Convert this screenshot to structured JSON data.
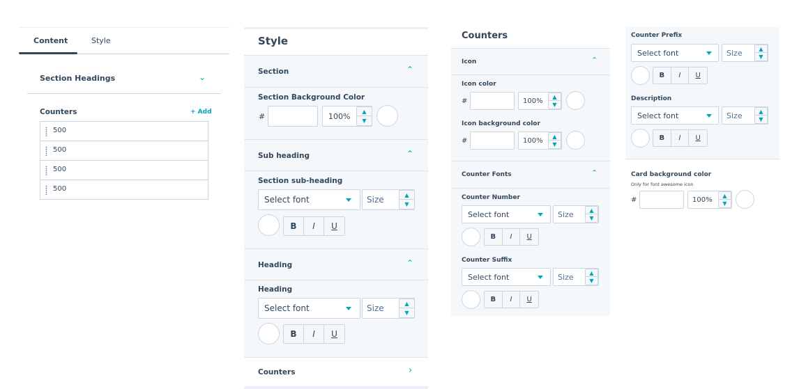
{
  "content_panel": {
    "tabs": [
      {
        "label": "Content"
      },
      {
        "label": "Style"
      }
    ],
    "section_headings_label": "Section Headings",
    "counters_label": "Counters",
    "add_label": "+ Add",
    "counter_items": [
      "500",
      "500",
      "500",
      "500"
    ]
  },
  "style_panel": {
    "title": "Style",
    "section": {
      "label": "Section",
      "bg_color_label": "Section Background Color",
      "hash": "#",
      "hex_value": "",
      "opacity": "100%"
    },
    "sub_heading": {
      "label": "Sub heading",
      "field_label": "Section sub-heading",
      "font_placeholder": "Select font",
      "size_placeholder": "Size"
    },
    "heading": {
      "label": "Heading",
      "field_label": "Heading",
      "font_placeholder": "Select font",
      "size_placeholder": "Size"
    },
    "counters_label": "Counters"
  },
  "counters_style": {
    "title": "Counters",
    "icon": {
      "label": "Icon",
      "icon_color_label": "Icon color",
      "icon_bg_label": "Icon background color",
      "hash": "#",
      "opacity": "100%"
    },
    "fonts": {
      "label": "Counter Fonts",
      "number_label": "Counter Number",
      "suffix_label": "Counter Suffix",
      "font_placeholder": "Select font",
      "size_placeholder": "Size"
    }
  },
  "counters_extra": {
    "prefix_label": "Counter Prefix",
    "description_label": "Description",
    "font_placeholder": "Select font",
    "size_placeholder": "Size",
    "card_bg_label": "Card background color",
    "card_bg_hint": "Only for font awesome icon",
    "hash": "#",
    "opacity": "100%"
  },
  "format_buttons": {
    "bold": "B",
    "italic": "I",
    "underline": "U"
  },
  "icons": {
    "chevron_up": "chevron-up-icon",
    "chevron_down": "chevron-down-icon",
    "chevron_right": "chevron-right-icon",
    "drag": "drag-handle-icon"
  },
  "colors": {
    "accent": "#00a4bd",
    "text": "#33475b",
    "border": "#cbd6e2",
    "panel_bg": "#f5f8fa"
  }
}
